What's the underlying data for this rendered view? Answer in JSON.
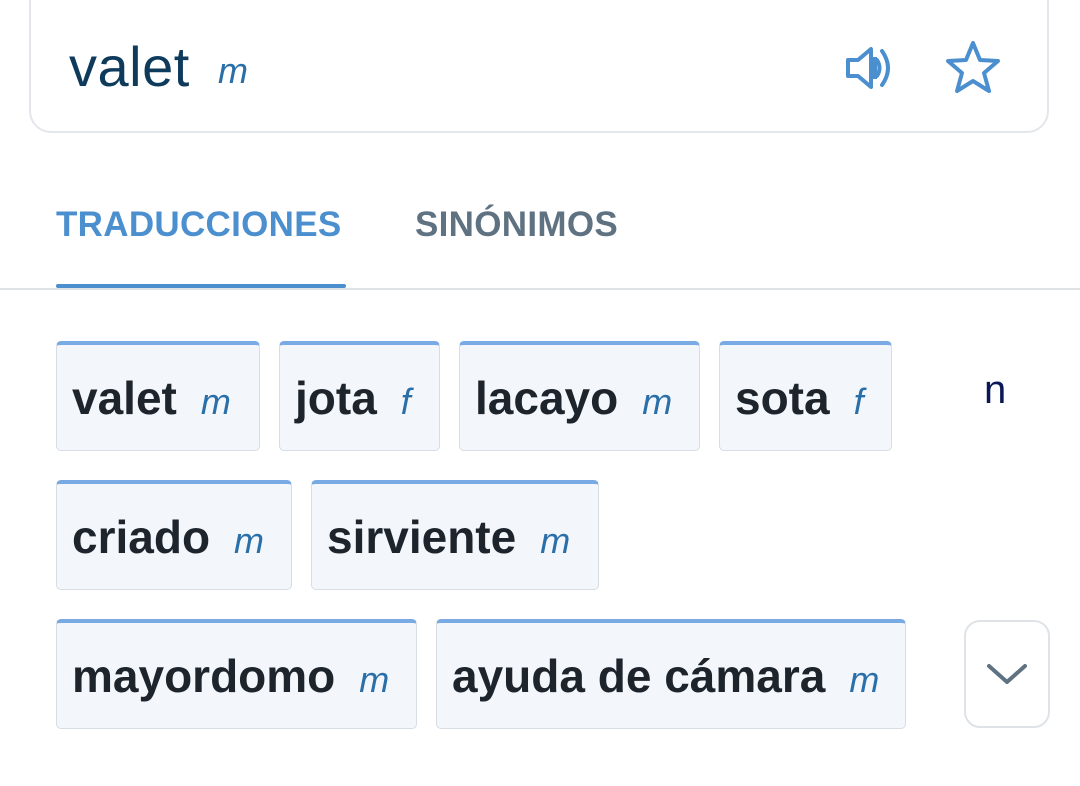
{
  "headword": {
    "word": "valet",
    "gender": "m",
    "speaker_icon": "speaker-icon",
    "star_icon": "star-icon"
  },
  "tabs": [
    {
      "label": "TRADUCCIONES",
      "active": true
    },
    {
      "label": "SINÓNIMOS",
      "active": false
    }
  ],
  "translations": [
    {
      "word": "valet",
      "gender": "m"
    },
    {
      "word": "jota",
      "gender": "f"
    },
    {
      "word": "lacayo",
      "gender": "m"
    },
    {
      "word": "sota",
      "gender": "f"
    },
    {
      "word": "criado",
      "gender": "m"
    },
    {
      "word": "sirviente",
      "gender": "m"
    },
    {
      "word": "mayordomo",
      "gender": "m"
    },
    {
      "word": "ayuda de cámara",
      "gender": "m"
    }
  ],
  "stray_text": "n",
  "expand_icon": "chevron-down-icon",
  "colors": {
    "accent": "#4b8fcf",
    "headword": "#0e3a5c",
    "gender": "#2b6fa8",
    "chip_bg": "#f3f7fc",
    "chip_top_border": "#7aaae3",
    "inactive_tab": "#5f7282"
  }
}
